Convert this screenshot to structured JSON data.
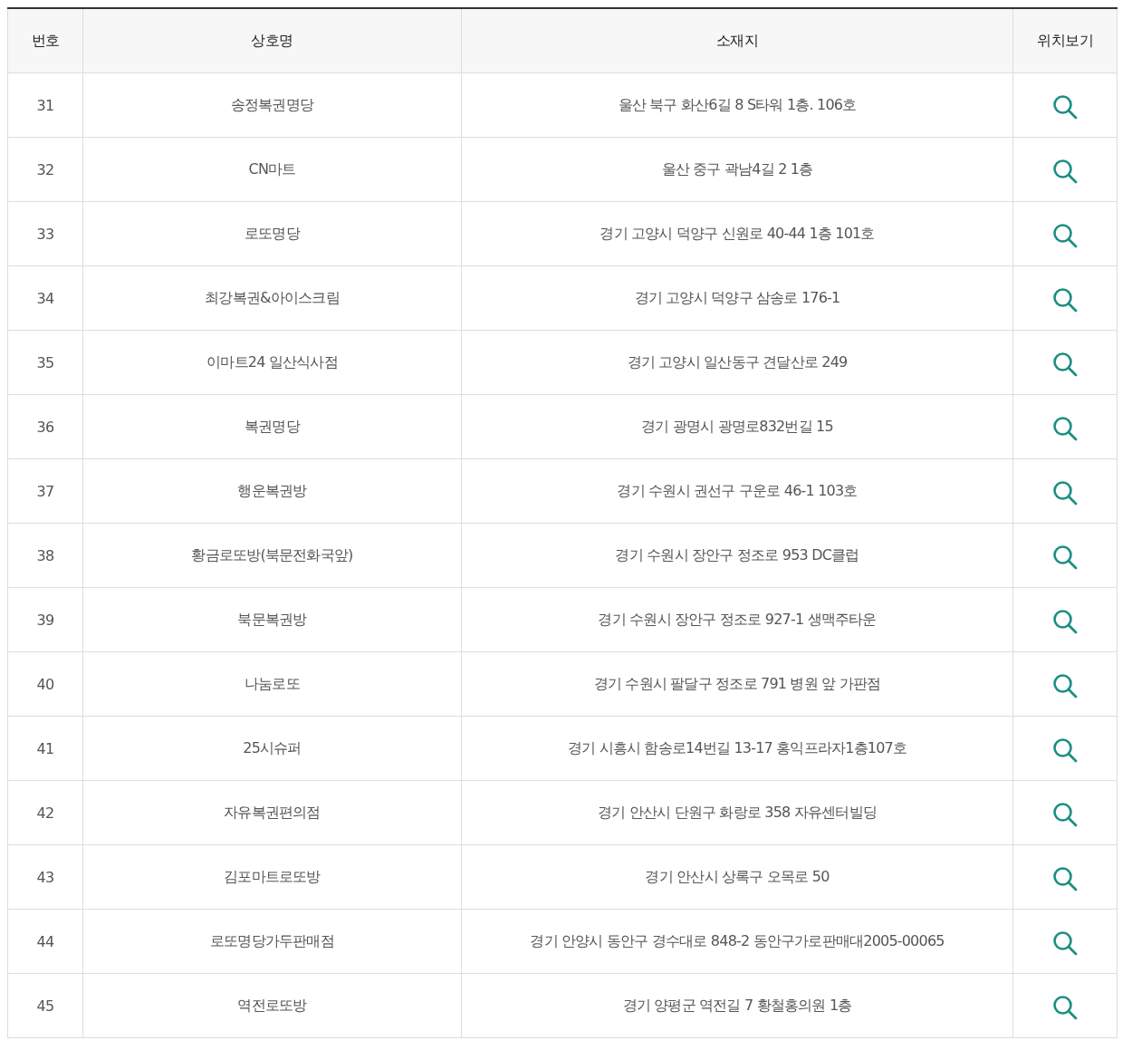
{
  "table": {
    "columns": [
      "번호",
      "상호명",
      "소재지",
      "위치보기"
    ],
    "rows": [
      {
        "number": "31",
        "name": "송정복권명당",
        "address": "울산 북구 화산6길 8 S타워 1층. 106호"
      },
      {
        "number": "32",
        "name": "CN마트",
        "address": "울산 중구 곽남4길 2 1층"
      },
      {
        "number": "33",
        "name": "로또명당",
        "address": "경기 고양시 덕양구 신원로 40-44 1층 101호"
      },
      {
        "number": "34",
        "name": "최강복권&아이스크림",
        "address": "경기 고양시 덕양구 삼송로 176-1"
      },
      {
        "number": "35",
        "name": "이마트24 일산식사점",
        "address": "경기 고양시 일산동구 견달산로 249"
      },
      {
        "number": "36",
        "name": "복권명당",
        "address": "경기 광명시 광명로832번길 15"
      },
      {
        "number": "37",
        "name": "행운복권방",
        "address": "경기 수원시 권선구 구운로 46-1 103호"
      },
      {
        "number": "38",
        "name": "황금로또방(북문전화국앞)",
        "address": "경기 수원시 장안구 정조로 953 DC클럽"
      },
      {
        "number": "39",
        "name": "북문복권방",
        "address": "경기 수원시 장안구 정조로 927-1 생맥주타운"
      },
      {
        "number": "40",
        "name": "나눔로또",
        "address": "경기 수원시 팔달구 정조로 791 병원 앞 가판점"
      },
      {
        "number": "41",
        "name": "25시슈퍼",
        "address": "경기 시흥시 함송로14번길 13-17 홍익프라자1층107호"
      },
      {
        "number": "42",
        "name": "자유복권편의점",
        "address": "경기 안산시 단원구 화랑로 358 자유센터빌딩"
      },
      {
        "number": "43",
        "name": "김포마트로또방",
        "address": "경기 안산시 상록구 오목로 50"
      },
      {
        "number": "44",
        "name": "로또명당가두판매점",
        "address": "경기 안양시 동안구 경수대로 848-2 동안구가로판매대2005-00065"
      },
      {
        "number": "45",
        "name": "역전로또방",
        "address": "경기 양평군 역전길 7 황철홍의원 1층"
      }
    ]
  }
}
